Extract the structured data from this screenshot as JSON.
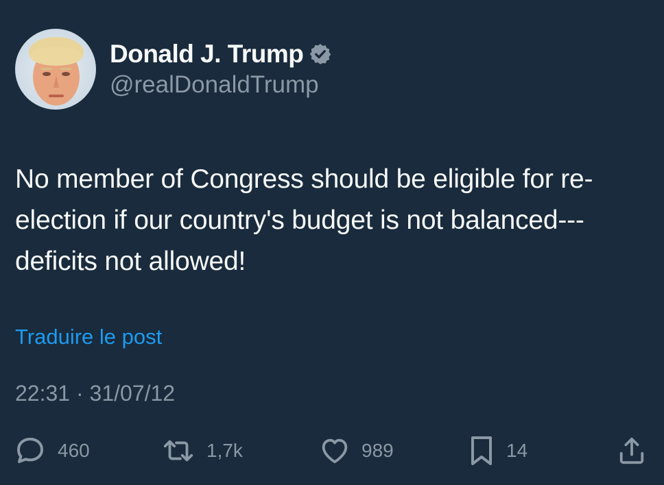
{
  "author": {
    "display_name": "Donald J. Trump",
    "handle": "@realDonaldTrump",
    "verified": true,
    "avatar": "profile-photo"
  },
  "post": {
    "text": "No member of Congress should be eligible for re-election if our country's budget is not balanced---deficits not allowed!",
    "translate_label": "Traduire le post",
    "time": "22:31",
    "separator": "·",
    "date": "31/07/12"
  },
  "actions": {
    "replies": {
      "icon": "reply-icon",
      "count": "460"
    },
    "reposts": {
      "icon": "repost-icon",
      "count": "1,7k"
    },
    "likes": {
      "icon": "heart-icon",
      "count": "989"
    },
    "bookmarks": {
      "icon": "bookmark-icon",
      "count": "14"
    },
    "share": {
      "icon": "share-icon"
    }
  },
  "colors": {
    "background": "#192b3c",
    "text_primary": "#f7f9f9",
    "text_secondary": "#8b98a5",
    "link": "#1d9bf0",
    "verified_badge": "#8b98a5"
  }
}
